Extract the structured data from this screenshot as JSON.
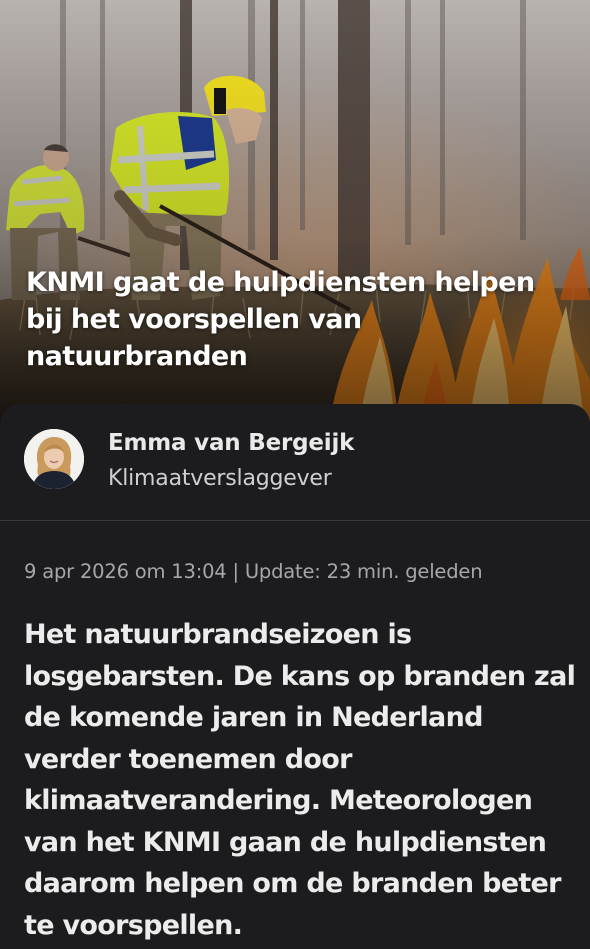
{
  "article": {
    "title": "KNMI gaat de hulpdiensten helpen bij het voorspellen van natuurbranden",
    "hero_image_alt": "Brandweerlieden bestrijden een natuurbrand"
  },
  "author": {
    "name": "Emma van Bergeijk",
    "role": "Klimaatverslaggever"
  },
  "meta": {
    "dateline": "9 apr 2026 om 13:04 | Update: 23 min. geleden"
  },
  "lead": {
    "text": "Het natuurbrandseizoen is losgebarsten. De kans op branden zal de komende jaren in Nederland verder toenemen door klimaatverandering. Meteorologen van het KNMI gaan de hulpdiensten daarom helpen om de branden beter te voorspellen."
  },
  "colors": {
    "sheet_background": "#1c1c1e",
    "divider": "#3a3a3c",
    "text_primary": "#ececed",
    "text_secondary": "#a7a7ab",
    "hi_vis_yellow": "#d6e82a",
    "fire_orange": "#f08a1a"
  }
}
